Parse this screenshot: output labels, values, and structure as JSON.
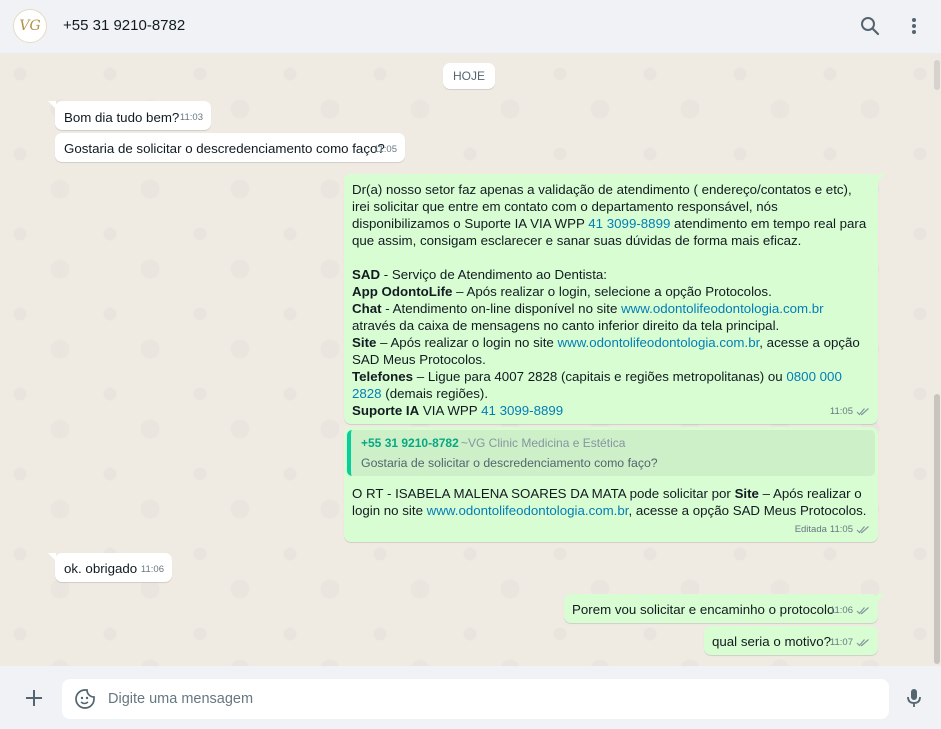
{
  "header": {
    "avatar_text": "VG",
    "contact_name": "+55 31 9210-8782",
    "search_icon": "search-icon",
    "menu_icon": "more-vertical-icon"
  },
  "chat": {
    "date_chip": "HOJE",
    "messages": [
      {
        "text": "Bom dia tudo bem?",
        "time": "11:03"
      },
      {
        "text": "Gostaria de solicitar o descredenciamento como faço?",
        "time": "11:05"
      },
      {
        "p1_a": "Dr(a) nosso setor faz apenas a validação de atendimento ( endereço/contatos e etc), irei solicitar que entre em contato com o departamento responsável, nós disponibilizamos o Suporte IA VIA WPP ",
        "p1_link": "41 3099-8899",
        "p1_b": " atendimento em tempo real para que assim, consigam esclarecer e sanar suas dúvidas de forma mais eficaz.",
        "sad_label": "SAD",
        "sad_text": " - Serviço de Atendimento ao Dentista:",
        "app_label": "App OdontoLife",
        "app_text": " – Após realizar o login, selecione a opção Protocolos.",
        "chat_label": "Chat",
        "chat_text_a": " - Atendimento on-line disponível no site ",
        "chat_link": "www.odontolifeodontologia.com.br",
        "chat_text_b": " através da caixa de mensagens no canto inferior direito da tela principal.",
        "site_label": "Site",
        "site_text_a": " – Após realizar o login no site ",
        "site_link": "www.odontolifeodontologia.com.br",
        "site_text_b": ", acesse a opção SAD Meus Protocolos.",
        "tel_label": "Telefones",
        "tel_text_a": " – Ligue para 4007 2828 (capitais e regiões metropolitanas) ou ",
        "tel_link": "0800 000 2828",
        "tel_text_b": " (demais regiões).",
        "sup_label": "Suporte IA",
        "sup_text": " VIA WPP ",
        "sup_link": "41 3099-8899",
        "time": "11:05"
      },
      {
        "quote_name": "+55 31 9210-8782",
        "quote_pushname": "~VG Clinic Medicina e Estética",
        "quote_text": "Gostaria de solicitar o descredenciamento como faço?",
        "text_a": "O RT -  ISABELA MALENA SOARES DA MATA pode solicitar por ",
        "text_bold": "Site",
        "text_b": " – Após realizar o login no site ",
        "link": "www.odontolifeodontologia.com.br",
        "text_c": ", acesse a opção SAD Meus Protocolos.",
        "edited": "Editada",
        "time": "11:05"
      },
      {
        "text": "ok. obrigado",
        "time": "11:06"
      },
      {
        "text": "Porem vou solicitar e encaminho o protocolo",
        "time": "11:06"
      },
      {
        "text": "qual seria o motivo?",
        "time": "11:07"
      }
    ]
  },
  "footer": {
    "attach_icon": "plus-icon",
    "emoji_icon": "sticker-icon",
    "placeholder": "Digite uma mensagem",
    "mic_icon": "mic-icon"
  },
  "colors": {
    "outgoing_bubble": "#d9fdd3",
    "incoming_bubble": "#ffffff",
    "link": "#027eb5",
    "quote_accent": "#06cf9c"
  }
}
